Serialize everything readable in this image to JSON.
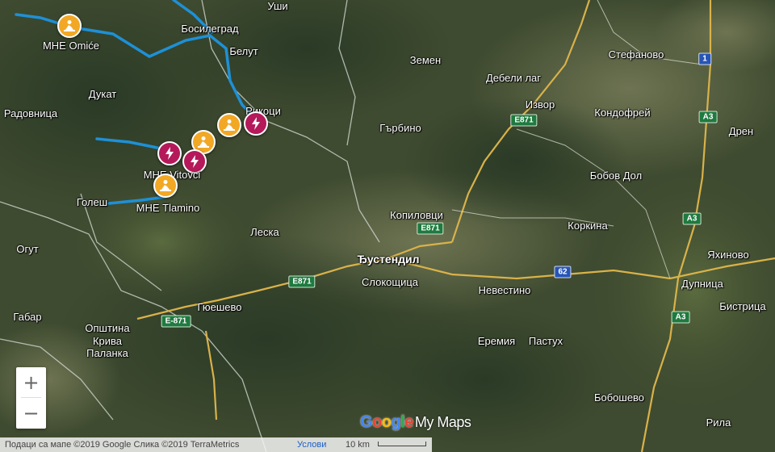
{
  "map": {
    "background_color": "#3d4a2e",
    "river_color": "#1e90d6",
    "road_color": "#d9b24a",
    "border_color": "#cfd6cf"
  },
  "places": [
    {
      "name": "Уши"
    },
    {
      "name": "Босилеград"
    },
    {
      "name": "Белут"
    },
    {
      "name": "Дукат"
    },
    {
      "name": "Радовница"
    },
    {
      "name": "Рикоци"
    },
    {
      "name": "Голеш"
    },
    {
      "name": "Леска"
    },
    {
      "name": "Огут"
    },
    {
      "name": "Габар"
    },
    {
      "name": "Општина"
    },
    {
      "name": "Крива"
    },
    {
      "name": "Паланка"
    },
    {
      "name": "Гюешево"
    },
    {
      "name": "Земен"
    },
    {
      "name": "Дебели лаг"
    },
    {
      "name": "Стефаново"
    },
    {
      "name": "Извор"
    },
    {
      "name": "Кондофрей"
    },
    {
      "name": "Гърбино"
    },
    {
      "name": "Дрен"
    },
    {
      "name": "Бобов Дол"
    },
    {
      "name": "Копиловци"
    },
    {
      "name": "Коркина"
    },
    {
      "name": "Ђустендил"
    },
    {
      "name": "Слокощица"
    },
    {
      "name": "Невестино"
    },
    {
      "name": "Яхиново"
    },
    {
      "name": "Дупница"
    },
    {
      "name": "Бистрица"
    },
    {
      "name": "Еремия"
    },
    {
      "name": "Пастух"
    },
    {
      "name": "Бобошево"
    },
    {
      "name": "Рила"
    }
  ],
  "road_shields": [
    {
      "label": "E871",
      "color": "green"
    },
    {
      "label": "E871",
      "color": "green"
    },
    {
      "label": "E871",
      "color": "green"
    },
    {
      "label": "E-871",
      "color": "green"
    },
    {
      "label": "62",
      "color": "blue"
    },
    {
      "label": "A3",
      "color": "green"
    },
    {
      "label": "A3",
      "color": "green"
    },
    {
      "label": "A3",
      "color": "green"
    },
    {
      "label": "1",
      "color": "blue"
    }
  ],
  "markers": [
    {
      "type": "construction",
      "label": "МНЕ Omiće",
      "icon": "worker-icon"
    },
    {
      "type": "construction",
      "label": "",
      "icon": "worker-icon"
    },
    {
      "type": "power",
      "label": "",
      "icon": "lightning-icon"
    },
    {
      "type": "construction",
      "label": "",
      "icon": "worker-icon"
    },
    {
      "type": "power",
      "label": "",
      "icon": "lightning-icon"
    },
    {
      "type": "power",
      "label": "МНЕ Vitovci",
      "icon": "lightning-icon"
    },
    {
      "type": "construction",
      "label": "МНЕ Tlamino",
      "icon": "worker-icon"
    }
  ],
  "marker_colors": {
    "construction": "#f2a825",
    "power": "#b5195a"
  },
  "controls": {
    "zoom_in": "+",
    "zoom_out": "−"
  },
  "logo": {
    "google": [
      "G",
      "o",
      "o",
      "g",
      "l",
      "e"
    ],
    "google_colors": [
      "#4285f4",
      "#ea4335",
      "#fbbc05",
      "#4285f4",
      "#34a853",
      "#ea4335"
    ],
    "product": "My Maps"
  },
  "footer": {
    "attribution": "Подаци са мапе ©2019 Google Слика ©2019 TerraMetrics",
    "terms": "Услови",
    "scale": "10 km"
  }
}
